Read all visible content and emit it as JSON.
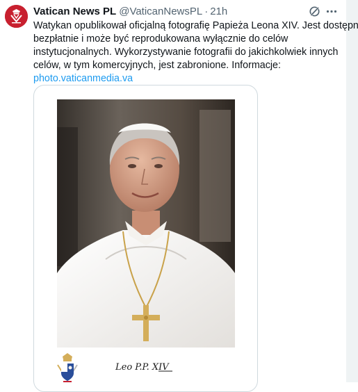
{
  "tweet": {
    "author": {
      "display_name": "Vatican News PL",
      "handle": "@VaticanNewsPL",
      "separator": "·",
      "time": "21h",
      "avatar_color": "#c8202f"
    },
    "text_lines": [
      "Watykan opublikował oficjalną fotografię Papieża Leona XIV. Jest dostępna",
      "bezpłatnie i może być reprodukowana wyłącznie do celów",
      "instytucjonalnych. Wykorzystywanie fotografii do jakichkolwiek innych",
      "celów, w tym komercyjnych, jest zabronione. Informacje:"
    ],
    "link_text": "photo.vaticanmedia.va",
    "link_color": "#1d9bf0",
    "actions": {
      "grok_icon": "grok-icon",
      "more_icon": "more-icon"
    },
    "media": {
      "portrait_icon": "pope-portrait-image",
      "coat_of_arms_icon": "papal-coat-of-arms",
      "signature": "Leo P.P. XIV"
    }
  }
}
